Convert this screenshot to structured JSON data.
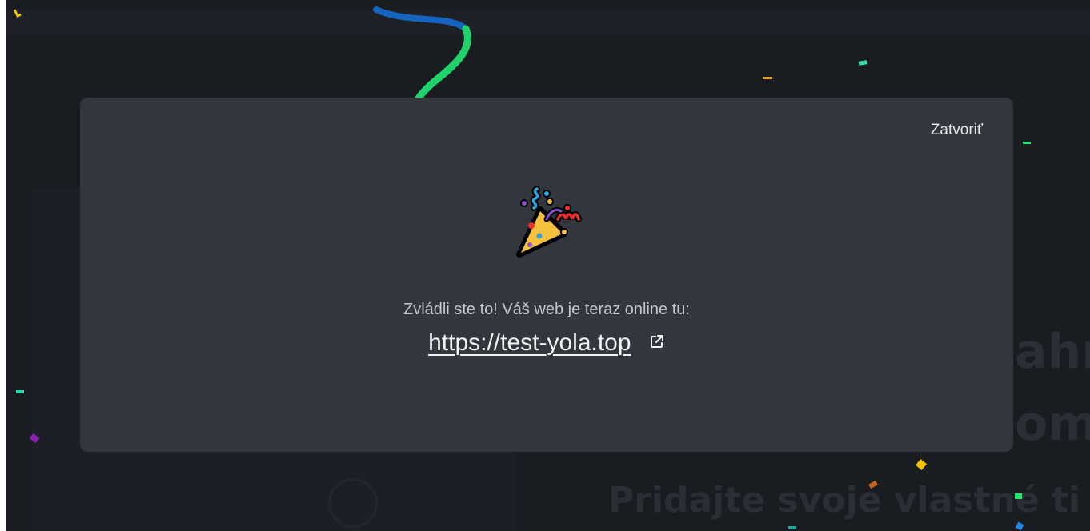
{
  "modal": {
    "close_label": "Zatvoriť",
    "message": "Zvládli ste to! Váš web je teraz online tu:",
    "site_url": "https://test-yola.top",
    "celebration_icon": "party-popper-icon",
    "link_icon": "external-link-icon"
  },
  "background": {
    "heading": "Pridajte svoje vlastné ti",
    "big_text_1": "ahr",
    "big_text_2": "om"
  },
  "colors": {
    "modal_bg": "#32363d",
    "page_bg": "#191c21",
    "text_primary": "#f2f3f5",
    "text_secondary": "#c3c6cb"
  }
}
